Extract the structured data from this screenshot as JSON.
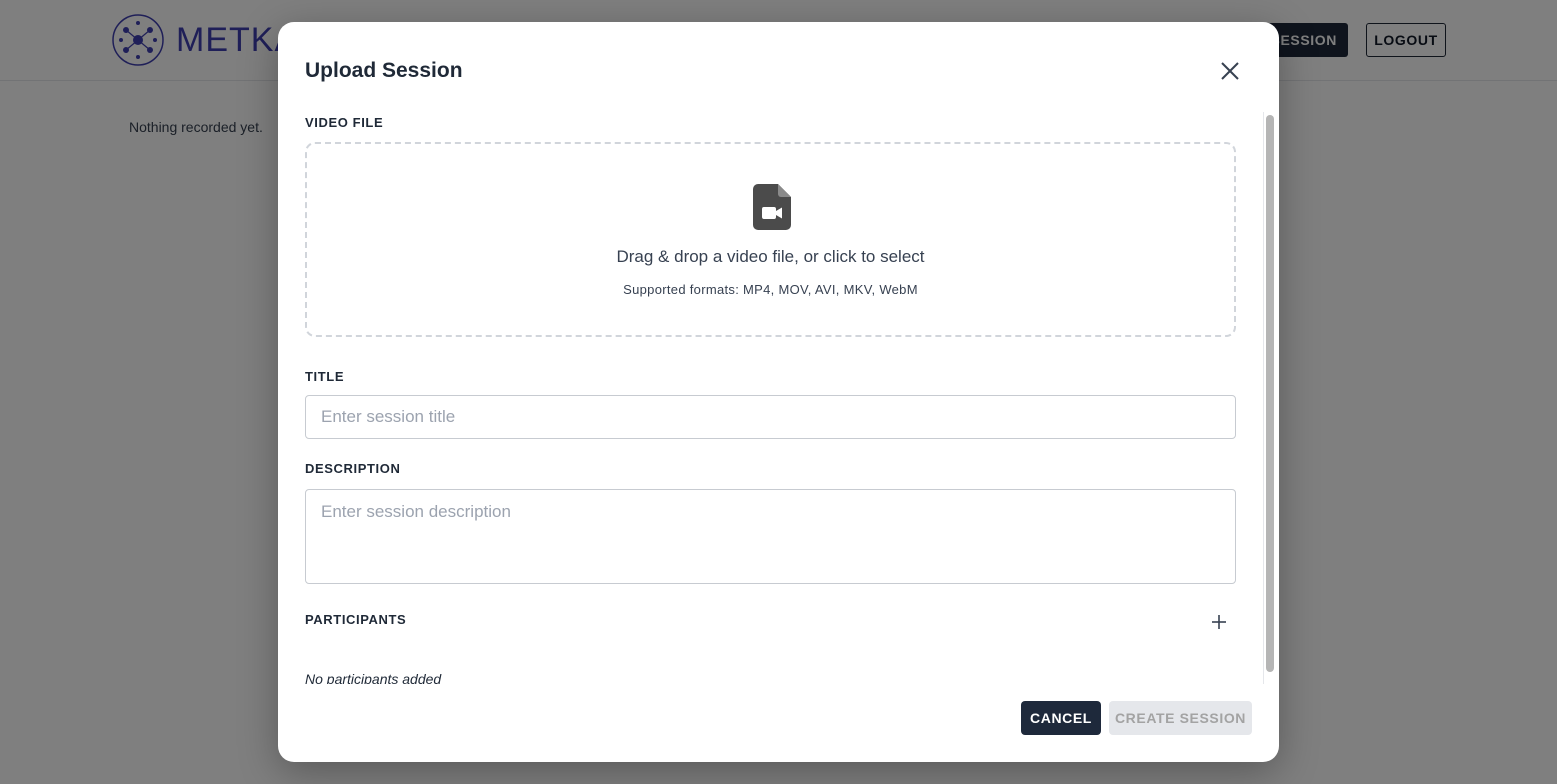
{
  "header": {
    "logo_text": "METKA",
    "upload_button_label": "SESSION",
    "logout_button_label": "LOGOUT"
  },
  "main": {
    "empty_text": "Nothing recorded yet."
  },
  "modal": {
    "title": "Upload Session",
    "close_icon": "close-icon",
    "video_file": {
      "label": "VIDEO FILE",
      "icon": "video-file-icon",
      "drop_text": "Drag & drop a video file, or click to select",
      "formats_text": "Supported formats: MP4, MOV, AVI, MKV, WebM"
    },
    "title_field": {
      "label": "TITLE",
      "value": "",
      "placeholder": "Enter session title"
    },
    "description_field": {
      "label": "DESCRIPTION",
      "value": "",
      "placeholder": "Enter session description"
    },
    "participants": {
      "label": "PARTICIPANTS",
      "add_icon": "plus-icon",
      "empty_text": "No participants added"
    },
    "footer": {
      "cancel_label": "CANCEL",
      "create_label": "CREATE SESSION"
    }
  },
  "colors": {
    "primary_dark": "#1e293b",
    "logo_accent": "#3f3fb0",
    "disabled_bg": "#e5e7eb",
    "disabled_text": "#a3a3a3"
  }
}
